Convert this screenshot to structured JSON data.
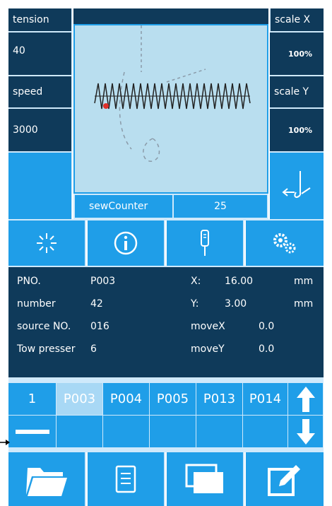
{
  "left_panel": {
    "tension_label": "tension",
    "tension_value": "40",
    "speed_label": "speed",
    "speed_value": "3000"
  },
  "right_panel": {
    "scale_x_label": "scale X",
    "scale_x_value": "100%",
    "scale_y_label": "scale Y",
    "scale_y_value": "100%"
  },
  "counter": {
    "label": "sewCounter",
    "value": "25"
  },
  "info": {
    "pno_label": "PNO.",
    "pno_value": "P003",
    "number_label": "number",
    "number_value": "42",
    "source_label": "source NO.",
    "source_value": "016",
    "presser_label": "Tow presser",
    "presser_value": "6",
    "x_label": "X:",
    "x_value": "16.00",
    "x_unit": "mm",
    "y_label": "Y:",
    "y_value": "3.00",
    "y_unit": "mm",
    "movex_label": "moveX",
    "movex_value": "0.0",
    "movey_label": "moveY",
    "movey_value": "0.0"
  },
  "pattern_list": {
    "page": "1",
    "items": [
      "P003",
      "P004",
      "P005",
      "P013",
      "P014"
    ],
    "selected": "P003"
  },
  "icons": {
    "toolbar": [
      "burst-icon",
      "info-icon",
      "needle-icon",
      "gears-icon"
    ],
    "bottom": [
      "folder-icon",
      "document-icon",
      "copy-icon",
      "edit-icon"
    ],
    "arrows": [
      "arrow-up-icon",
      "arrow-down-icon"
    ]
  },
  "colors": {
    "dark": "#0f3a5a",
    "blue": "#1f9ee8",
    "canvas": "#b9deef",
    "highlight": "#a8d8f5"
  }
}
